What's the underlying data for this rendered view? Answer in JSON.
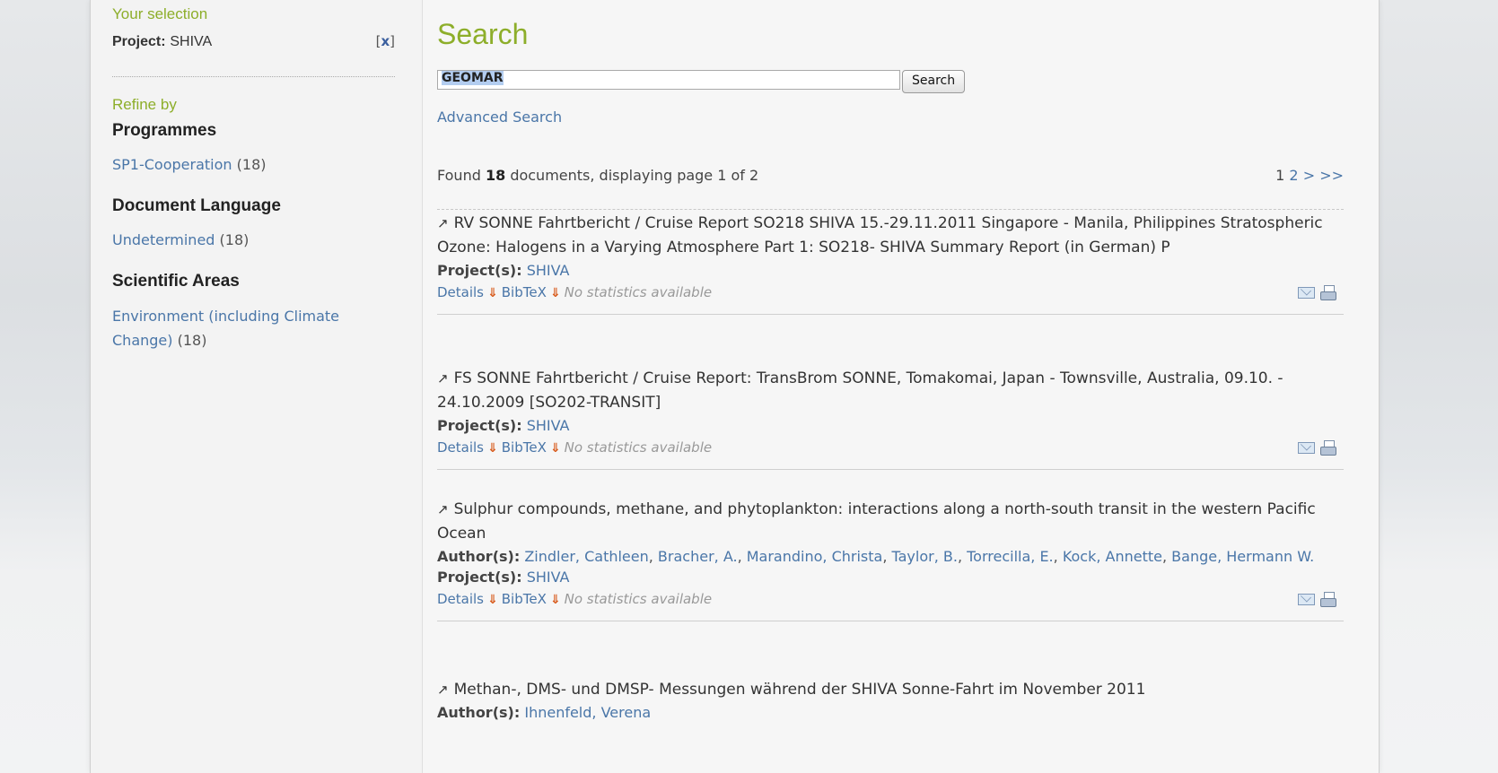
{
  "sidebar": {
    "your_selection_label": "Your selection",
    "selection_key": "Project:",
    "selection_value": "SHIVA",
    "remove_open": "[",
    "remove_x": "x",
    "remove_close": "]",
    "refine_label": "Refine by",
    "facets": [
      {
        "heading": "Programmes",
        "items": [
          {
            "label": "SP1-Cooperation",
            "count": "(18)"
          }
        ]
      },
      {
        "heading": "Document Language",
        "items": [
          {
            "label": "Undetermined",
            "count": "(18)"
          }
        ]
      },
      {
        "heading": "Scientific Areas",
        "items": [
          {
            "label": "Environment (including Climate Change)",
            "count": "(18)"
          }
        ]
      }
    ]
  },
  "main": {
    "title": "Search",
    "search_value": "GEOMAR",
    "search_button": "Search",
    "advanced_link": "Advanced Search",
    "found_prefix": "Found",
    "found_count": "18",
    "found_suffix": "documents, displaying page 1 of 2",
    "pager": {
      "current": "1",
      "next_page": "2",
      "next": ">",
      "last": ">>"
    },
    "icons": {
      "external": "external-link-icon",
      "download": "download-arrow-icon",
      "mail": "mail-icon",
      "print": "print-icon"
    },
    "results": [
      {
        "title": "RV SONNE Fahrtbericht / Cruise Report SO218 SHIVA 15.-29.11.2011 Singapore - Manila, Philippines Stratospheric Ozone: Halogens in a Varying Atmosphere Part 1: SO218- SHIVA Summary Report (in German) P",
        "authors_label": "",
        "authors": [],
        "project_label": "Project(s):",
        "project": "SHIVA",
        "details": "Details",
        "bibtex": "BibTeX",
        "stats": "No statistics available"
      },
      {
        "title": "FS SONNE Fahrtbericht / Cruise Report: TransBrom SONNE, Tomakomai, Japan - Townsville, Australia, 09.10. - 24.10.2009 [SO202-TRANSIT]",
        "authors_label": "",
        "authors": [],
        "project_label": "Project(s):",
        "project": "SHIVA",
        "details": "Details",
        "bibtex": "BibTeX",
        "stats": "No statistics available"
      },
      {
        "title": "Sulphur compounds, methane, and phytoplankton: interactions along a north-south transit in the western Pacific Ocean",
        "authors_label": "Author(s):",
        "authors": [
          "Zindler, Cathleen",
          "Bracher, A.",
          "Marandino, Christa",
          "Taylor, B.",
          "Torrecilla, E.",
          "Kock, Annette",
          "Bange, Hermann W."
        ],
        "project_label": "Project(s):",
        "project": "SHIVA",
        "details": "Details",
        "bibtex": "BibTeX",
        "stats": "No statistics available"
      },
      {
        "title": "Methan-, DMS- und DMSP- Messungen während der SHIVA Sonne-Fahrt im November 2011",
        "authors_label": "Author(s):",
        "authors": [
          "Ihnenfeld, Verena"
        ],
        "project_label": "",
        "project": "",
        "details": "",
        "bibtex": "",
        "stats": ""
      }
    ]
  }
}
